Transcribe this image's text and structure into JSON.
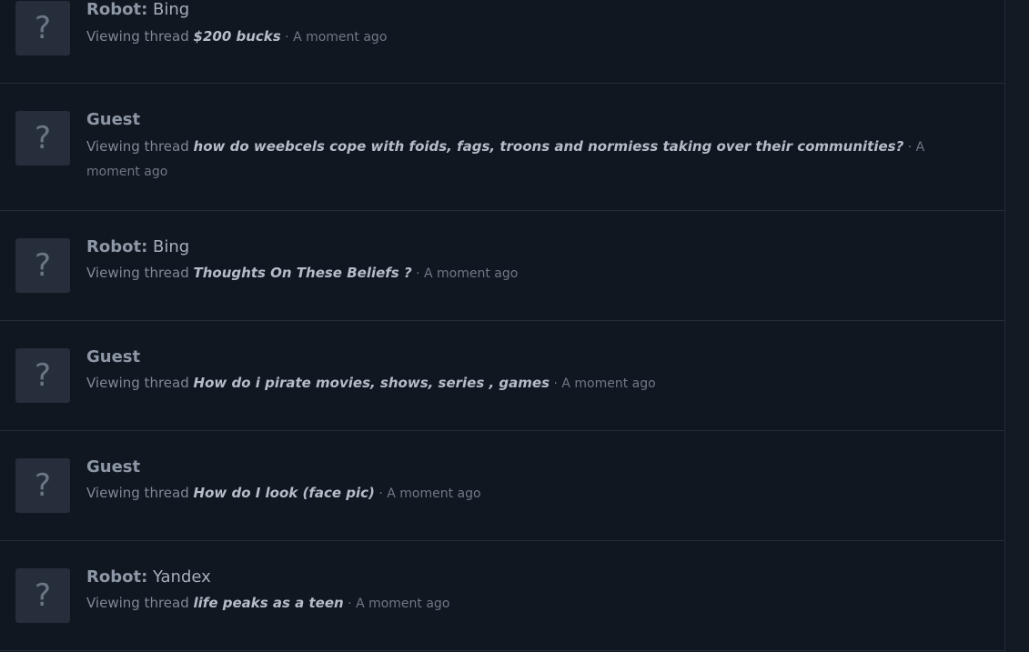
{
  "rows": [
    {
      "name_prefix": "Robot:",
      "name": " Bing",
      "action": "Viewing thread",
      "thread": "$200 bucks",
      "separator": " · ",
      "time": "A moment ago"
    },
    {
      "name_prefix": "",
      "name": "Guest",
      "action": "Viewing thread",
      "thread": "how do weebcels cope with foids, fags, troons and normiess taking over their communities?",
      "separator": " · ",
      "time": "A moment ago"
    },
    {
      "name_prefix": "Robot:",
      "name": " Bing",
      "action": "Viewing thread",
      "thread": "Thoughts On These Beliefs ?",
      "separator": " · ",
      "time": "A moment ago"
    },
    {
      "name_prefix": "",
      "name": "Guest",
      "action": "Viewing thread",
      "thread": "How do i pirate movies, shows, series , games",
      "separator": " · ",
      "time": "A moment ago"
    },
    {
      "name_prefix": "",
      "name": "Guest",
      "action": "Viewing thread",
      "thread": "How do I look (face pic)",
      "separator": " · ",
      "time": "A moment ago"
    },
    {
      "name_prefix": "Robot:",
      "name": " Yandex",
      "action": "Viewing thread",
      "thread": "life peaks as a teen",
      "separator": " · ",
      "time": "A moment ago"
    }
  ],
  "avatar_glyph": "?"
}
